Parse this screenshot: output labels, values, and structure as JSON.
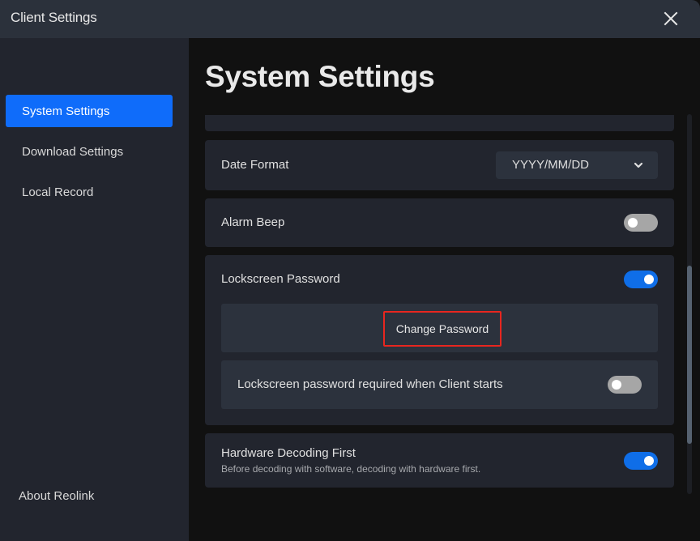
{
  "window": {
    "title": "Client Settings",
    "close_icon": "close-icon"
  },
  "sidebar": {
    "items": [
      {
        "label": "System Settings",
        "active": true
      },
      {
        "label": "Download Settings",
        "active": false
      },
      {
        "label": "Local Record",
        "active": false
      }
    ],
    "about_label": "About Reolink"
  },
  "main": {
    "title": "System Settings",
    "settings": {
      "date_format": {
        "label": "Date Format",
        "value": "YYYY/MM/DD",
        "dropdown_icon": "chevron-down-icon"
      },
      "alarm_beep": {
        "label": "Alarm Beep",
        "enabled": false
      },
      "lockscreen_password": {
        "label": "Lockscreen Password",
        "enabled": true,
        "change_password_label": "Change Password",
        "required_on_start": {
          "label": "Lockscreen password required when Client starts",
          "enabled": false
        }
      },
      "hardware_decoding": {
        "label": "Hardware Decoding First",
        "description": "Before decoding with software, decoding with hardware first.",
        "enabled": true
      }
    }
  },
  "colors": {
    "accent": "#0f6cfa",
    "toggle_on": "#0f6ee8",
    "toggle_off": "#a6a6a6",
    "highlight_border": "#e8261f"
  }
}
